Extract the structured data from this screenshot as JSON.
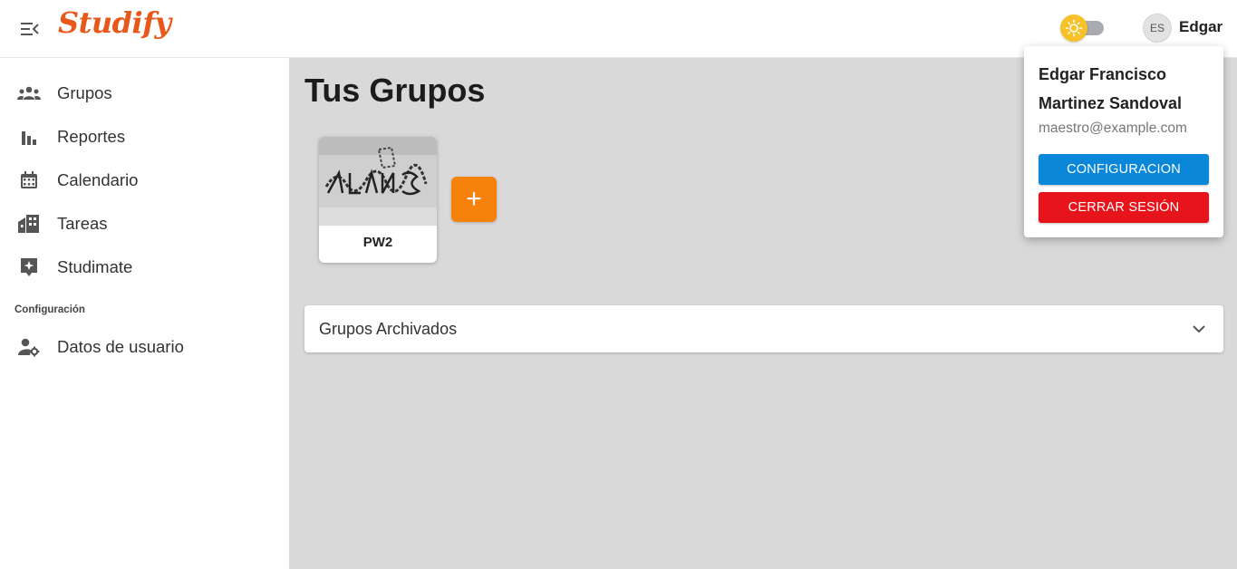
{
  "header": {
    "logo_text": "Studify",
    "avatar_initials": "ES",
    "user_name": "Edgar",
    "theme_toggle": {
      "icon": "sun-icon",
      "state": "light"
    }
  },
  "sidebar": {
    "items": [
      {
        "label": "Grupos",
        "icon": "groups-icon"
      },
      {
        "label": "Reportes",
        "icon": "bar-chart-icon"
      },
      {
        "label": "Calendario",
        "icon": "calendar-icon"
      },
      {
        "label": "Tareas",
        "icon": "buildings-icon"
      },
      {
        "label": "Studimate",
        "icon": "sparkle-icon"
      }
    ],
    "section_label": "Configuración",
    "settings_items": [
      {
        "label": "Datos de usuario",
        "icon": "user-settings-icon"
      }
    ]
  },
  "main": {
    "title": "Tus Grupos",
    "groups": [
      {
        "name": "PW2"
      }
    ],
    "add_button_label": "+",
    "archived_label": "Grupos Archivados"
  },
  "user_menu": {
    "name_line1": "Edgar Francisco",
    "name_line2": "Martinez Sandoval",
    "email": "maestro@example.com",
    "config_button": "CONFIGURACION",
    "logout_button": "CERRAR SESIÓN"
  },
  "colors": {
    "brand": "#e8581a",
    "main_bg": "#d9d9d9",
    "add_button": "#f6820c",
    "config_button": "#0a87d8",
    "logout_button": "#e8141b",
    "theme_knob": "#f6c22b"
  }
}
